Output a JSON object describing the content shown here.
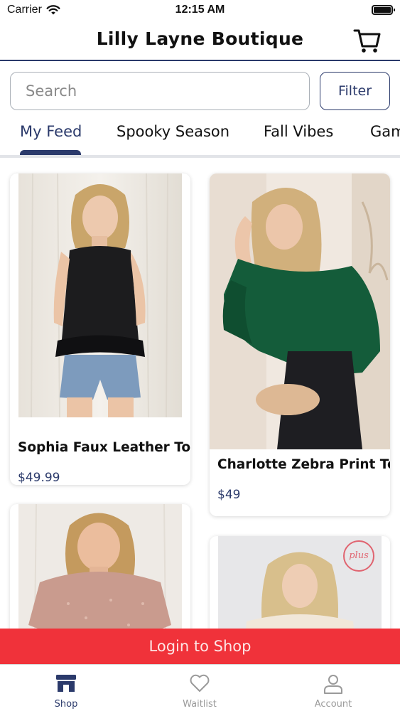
{
  "status_bar": {
    "carrier": "Carrier",
    "time": "12:15 AM"
  },
  "header": {
    "title": "Lilly Layne Boutique",
    "cart_icon": "cart-icon"
  },
  "search": {
    "placeholder": "Search",
    "value": ""
  },
  "filter": {
    "label": "Filter"
  },
  "tabs": [
    {
      "label": "My Feed",
      "active": true
    },
    {
      "label": "Spooky Season",
      "active": false
    },
    {
      "label": "Fall Vibes",
      "active": false
    },
    {
      "label": "Gam",
      "active": false
    }
  ],
  "products": [
    {
      "name": "Sophia Faux Leather Top",
      "price": "$49.99"
    },
    {
      "name": "Charlotte Zebra Print Top",
      "price": "$49"
    },
    {
      "name": "",
      "price": ""
    },
    {
      "name": "",
      "price": ""
    }
  ],
  "badge": {
    "plus": "plus"
  },
  "login_banner": {
    "label": "Login to Shop"
  },
  "bottom_nav": [
    {
      "label": "Shop",
      "icon": "store-icon",
      "active": true
    },
    {
      "label": "Waitlist",
      "icon": "heart-icon",
      "active": false
    },
    {
      "label": "Account",
      "icon": "person-icon",
      "active": false
    }
  ],
  "colors": {
    "primary": "#2b3a6b",
    "banner": "#f0323a",
    "inactive": "#9a9a9a"
  }
}
